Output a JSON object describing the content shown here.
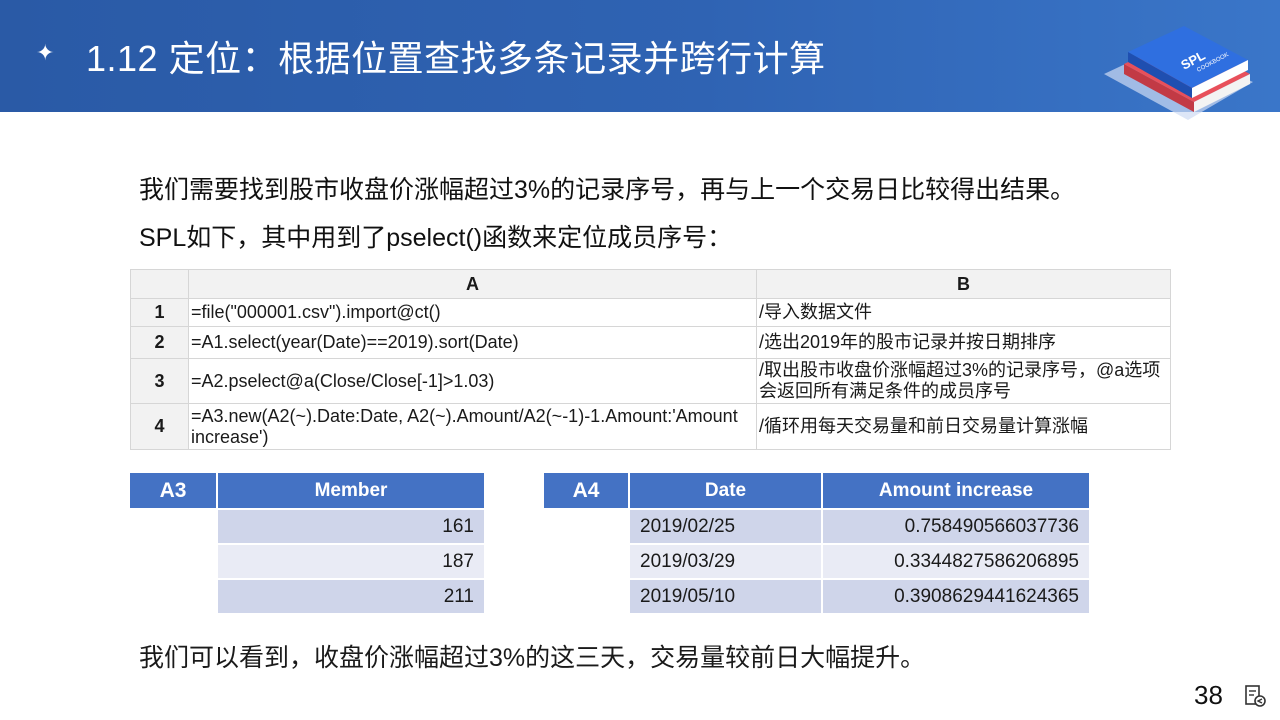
{
  "header": {
    "title": "1.12  定位：根据位置查找多条记录并跨行计算",
    "star_icon": "sparkle-icon",
    "book_label": "SPL",
    "book_sub": "COOKBOOK"
  },
  "intro": [
    "我们需要找到股市收盘价涨幅超过3%的记录序号，再与上一个交易日比较得出结果。",
    "SPL如下，其中用到了pselect()函数来定位成员序号："
  ],
  "spl": {
    "col_a": "A",
    "col_b": "B",
    "rows": [
      {
        "n": "1",
        "code": "=file(\"000001.csv\").import@ct()",
        "comment": "/导入数据文件"
      },
      {
        "n": "2",
        "code": "=A1.select(year(Date)==2019).sort(Date)",
        "comment": "/选出2019年的股市记录并按日期排序"
      },
      {
        "n": "3",
        "code": "=A2.pselect@a(Close/Close[-1]>1.03)",
        "comment": "/取出股市收盘价涨幅超过3%的记录序号，@a选项会返回所有满足条件的成员序号"
      },
      {
        "n": "4",
        "code": "=A3.new(A2(~).Date:Date, A2(~).Amount/A2(~-1)-1.Amount:'Amount increase')",
        "comment": "/循环用每天交易量和前日交易量计算涨幅"
      }
    ]
  },
  "result_a3": {
    "tag": "A3",
    "header": "Member",
    "values": [
      "161",
      "187",
      "211"
    ]
  },
  "result_a4": {
    "tag": "A4",
    "headers": [
      "Date",
      "Amount increase"
    ],
    "rows": [
      [
        "2019/02/25",
        "0.758490566037736"
      ],
      [
        "2019/03/29",
        "0.3344827586206895"
      ],
      [
        "2019/05/10",
        "0.3908629441624365"
      ]
    ]
  },
  "conclusion": "我们可以看到，收盘价涨幅超过3%的这三天，交易量较前日大幅提升。",
  "page": {
    "number": "38",
    "icon": "return-page-icon"
  },
  "colors": {
    "header": "#2f63b3",
    "table_head": "#4472c4",
    "cell_dark": "#cfd5ea",
    "cell_light": "#e9ebf5"
  }
}
